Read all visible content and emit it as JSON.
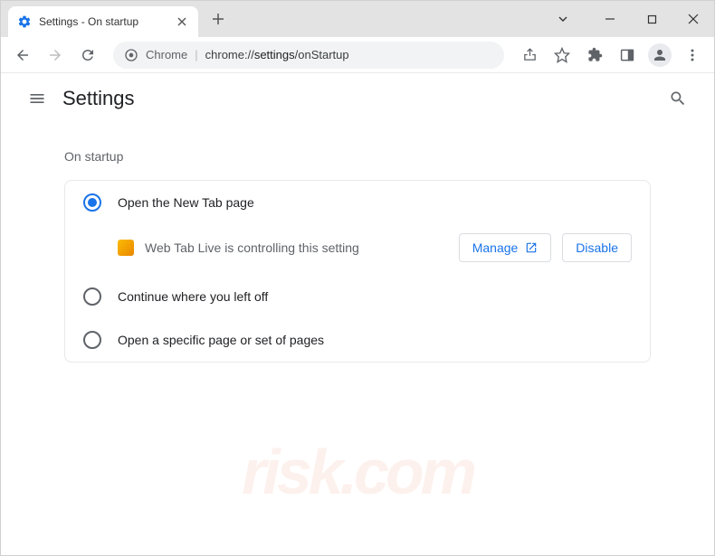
{
  "tab": {
    "title": "Settings - On startup"
  },
  "omnibox": {
    "chip": "Chrome",
    "url_prefix": "chrome://",
    "url_bold": "settings",
    "url_rest": "/onStartup"
  },
  "header": {
    "title": "Settings"
  },
  "section": {
    "title": "On startup"
  },
  "options": {
    "opt1": {
      "label": "Open the New Tab page",
      "selected": true
    },
    "controlled": {
      "text": "Web Tab Live is controlling this setting",
      "manage": "Manage",
      "disable": "Disable"
    },
    "opt2": {
      "label": "Continue where you left off"
    },
    "opt3": {
      "label": "Open a specific page or set of pages"
    }
  }
}
